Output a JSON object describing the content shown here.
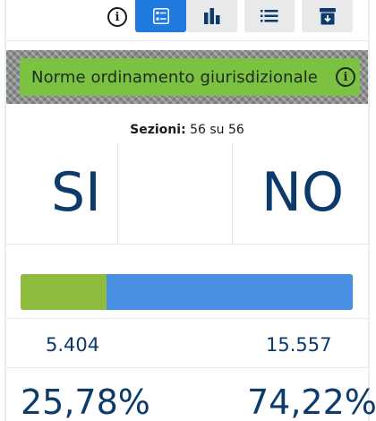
{
  "toolbar": {
    "info_icon": "info-circle-icon",
    "buttons": [
      {
        "name": "list-detail-view",
        "icon": "list-detail-icon",
        "active": true
      },
      {
        "name": "bar-chart-view",
        "icon": "bar-chart-icon",
        "active": false
      },
      {
        "name": "bulleted-list-view",
        "icon": "bulleted-list-icon",
        "active": false
      },
      {
        "name": "archive-download",
        "icon": "archive-download-icon",
        "active": false
      }
    ],
    "info_glyph": "i"
  },
  "banner": {
    "title": "Norme ordinamento giurisdizionale",
    "info_glyph": "i"
  },
  "sections": {
    "label": "Sezioni:",
    "value": "56 su 56"
  },
  "results": {
    "yes_label": "SI",
    "no_label": "NO",
    "yes_votes": "5.404",
    "no_votes": "15.557",
    "yes_percent_label": "25,78%",
    "no_percent_label": "74,22%",
    "yes_fraction": 0.2578
  },
  "colors": {
    "accent": "#1f7ae0",
    "banner_green": "#7cc242",
    "yes_green": "#8dbb3e",
    "no_blue": "#4a90e2",
    "text_navy": "#0b3a6b"
  }
}
